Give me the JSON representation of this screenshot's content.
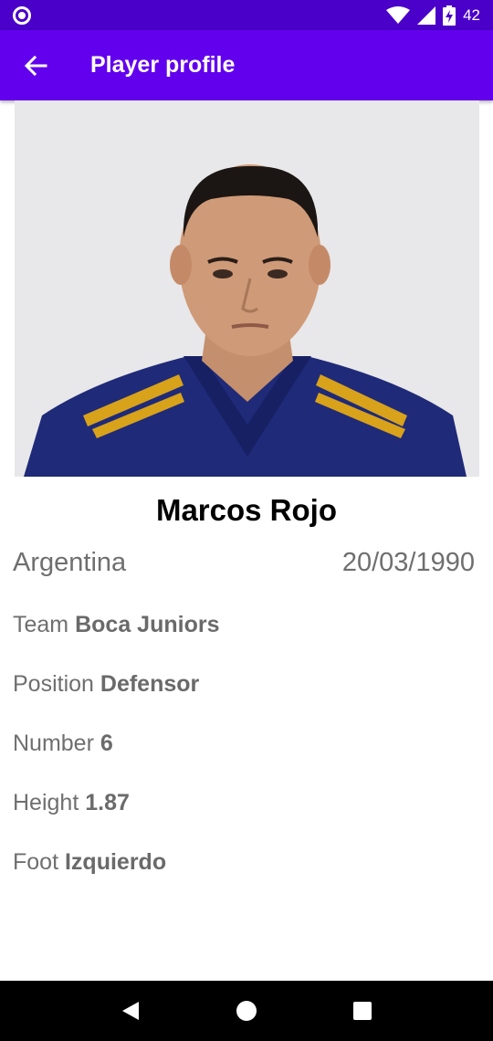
{
  "status_bar": {
    "battery_level": "42",
    "icons": [
      "wifi-icon",
      "signal-icon",
      "battery-charging-icon"
    ]
  },
  "app_bar": {
    "title": "Player profile",
    "background": "#6200ee"
  },
  "player": {
    "name": "Marcos Rojo",
    "country": "Argentina",
    "birth_date": "20/03/1990",
    "team_label": "Team",
    "team_value": "Boca Juniors",
    "position_label": "Position",
    "position_value": "Defensor",
    "number_label": "Number",
    "number_value": "6",
    "height_label": "Height",
    "height_value": "1.87",
    "foot_label": "Foot",
    "foot_value": "Izquierdo"
  },
  "nav": {
    "icons": [
      "back-triangle-icon",
      "home-circle-icon",
      "recents-square-icon"
    ]
  }
}
